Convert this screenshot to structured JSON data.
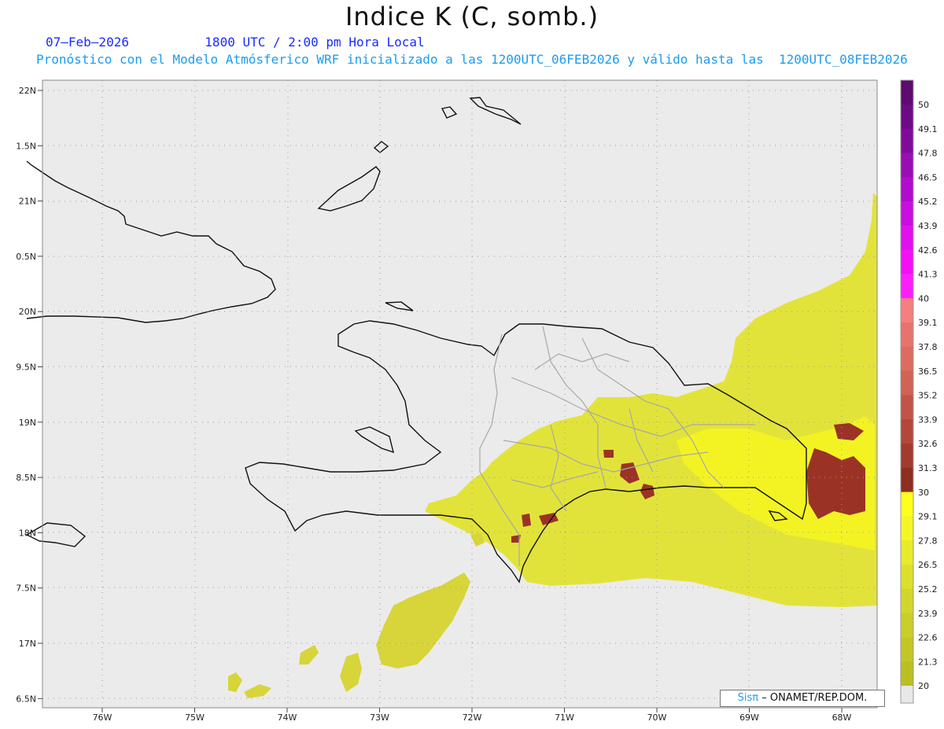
{
  "title": "Indice K (C, somb.)",
  "date": "07–Feb–2026",
  "time": "1800 UTC / 2:00 pm Hora Local",
  "subtitle": "Pronóstico con el Modelo Atmósferico WRF inicializado a las 1200UTC_06FEB2026 y válido hasta las  1200UTC_08FEB2026",
  "credit": {
    "logo": "Sisπ",
    "text": "– ONAMET/REP.DOM."
  },
  "lat_labels": [
    "22N",
    "1.5N",
    "21N",
    "0.5N",
    "20N",
    "9.5N",
    "19N",
    "8.5N",
    "18N",
    "7.5N",
    "17N",
    "6.5N"
  ],
  "lon_labels": [
    "76W",
    "75W",
    "74W",
    "73W",
    "72W",
    "71W",
    "70W",
    "69W",
    "68W"
  ],
  "colorbar": {
    "labels": [
      "50",
      "49.1",
      "47.8",
      "46.5",
      "45.2",
      "43.9",
      "42.6",
      "41.3",
      "40",
      "39.1",
      "37.8",
      "36.5",
      "35.2",
      "33.9",
      "32.6",
      "31.3",
      "30",
      "29.1",
      "27.8",
      "26.5",
      "25.2",
      "23.9",
      "22.6",
      "21.3",
      "20"
    ],
    "colors": [
      "#5e0a6e",
      "#6e0a85",
      "#800b9b",
      "#9a0cb4",
      "#b00ccd",
      "#c80ee0",
      "#e010ef",
      "#f40ff8",
      "#fb20fb",
      "#f57f7f",
      "#e8736d",
      "#de6b5f",
      "#d16354",
      "#c25346",
      "#b2473a",
      "#a23b2e",
      "#8d2e1e",
      "#ffff1e",
      "#f5f527",
      "#e8ea2a",
      "#dcdf2b",
      "#d2d62a",
      "#cace28",
      "#c4c626",
      "#bcbf22"
    ],
    "bottom_color": "#e8e8e8"
  },
  "legend_high_range": "30-40 (dark red)",
  "background_color": "#ebebeb"
}
